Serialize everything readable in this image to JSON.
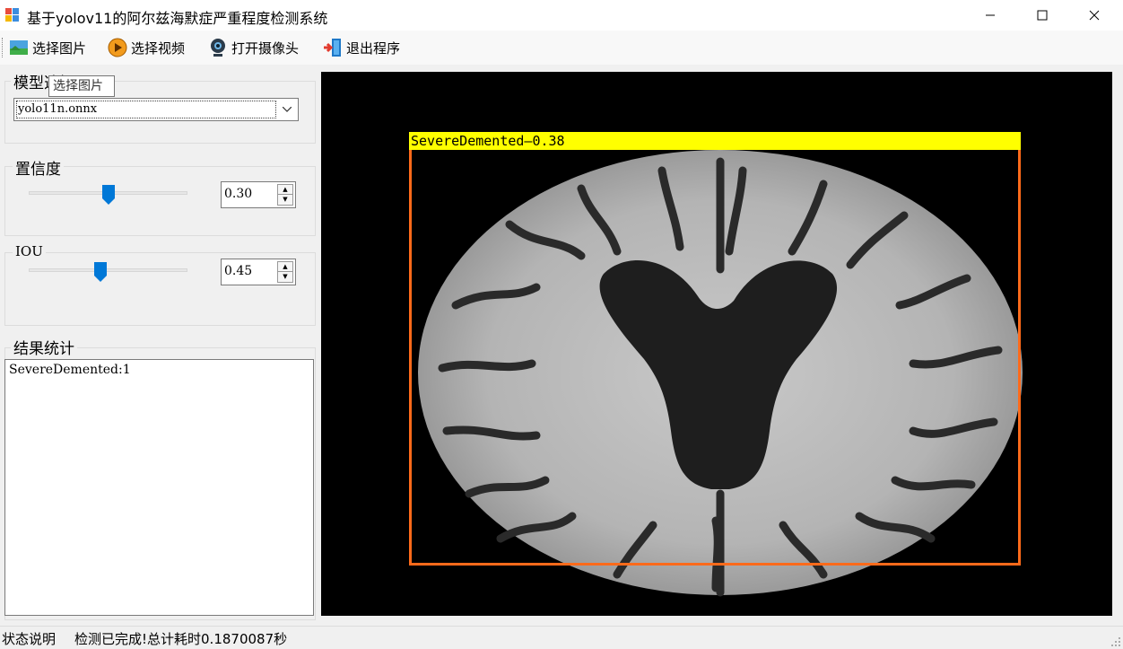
{
  "window": {
    "title": "基于yolov11的阿尔兹海默症严重程度检测系统",
    "controls": {
      "minimize": "—",
      "maximize": "☐",
      "close": "✕"
    }
  },
  "toolbar": {
    "items": [
      {
        "label": "选择图片",
        "icon": "picture-icon"
      },
      {
        "label": "选择视频",
        "icon": "play-icon"
      },
      {
        "label": "打开摄像头",
        "icon": "webcam-icon"
      },
      {
        "label": "退出程序",
        "icon": "exit-door-icon"
      }
    ]
  },
  "tooltip": {
    "text": "选择图片"
  },
  "model": {
    "group_label": "模型选择",
    "selected": "yolo11n.onnx"
  },
  "confidence": {
    "group_label": "置信度",
    "value": "0.30",
    "slider_level": 0.5
  },
  "iou": {
    "group_label": "IOU",
    "value": "0.45",
    "slider_level": 0.45
  },
  "results": {
    "group_label": "结果统计",
    "text": "SevereDemented:1"
  },
  "detection": {
    "label": "SevereDemented—0.38",
    "box_color": "#ff6a1a",
    "label_bg": "#ffff00"
  },
  "status": {
    "label": "状态说明",
    "message": "检测已完成!总计耗时0.1870087秒"
  },
  "colors": {
    "slider_thumb": "#0078d7",
    "image_bg": "#000000"
  }
}
